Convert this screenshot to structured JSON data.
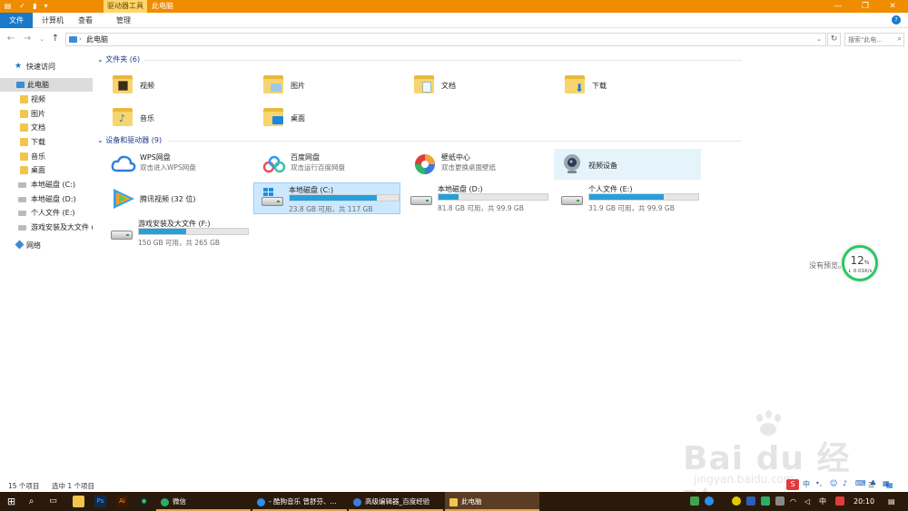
{
  "window": {
    "context_tab": "驱动器工具",
    "title": "此电脑",
    "minimize": "—",
    "maximize": "❐",
    "close": "✕"
  },
  "ribbon": {
    "tabs": [
      {
        "label": "文件"
      },
      {
        "label": "计算机"
      },
      {
        "label": "查看"
      },
      {
        "label": "管理"
      }
    ]
  },
  "address": {
    "path": "此电脑",
    "search_placeholder": "搜索\"此电...",
    "back": "←",
    "forward": "→",
    "history": "⌄",
    "up": "↑",
    "refresh": "↻"
  },
  "sidebar": {
    "items": [
      {
        "label": "快速访问",
        "icon": "star-icon"
      },
      {
        "label": "此电脑",
        "icon": "computer-icon"
      },
      {
        "label": "视频",
        "icon": "folder-icon"
      },
      {
        "label": "图片",
        "icon": "folder-icon"
      },
      {
        "label": "文档",
        "icon": "folder-icon"
      },
      {
        "label": "下载",
        "icon": "folder-icon"
      },
      {
        "label": "音乐",
        "icon": "folder-icon"
      },
      {
        "label": "桌面",
        "icon": "folder-icon"
      },
      {
        "label": "本地磁盘 (C:)",
        "icon": "drive-icon"
      },
      {
        "label": "本地磁盘 (D:)",
        "icon": "drive-icon"
      },
      {
        "label": "个人文件 (E:)",
        "icon": "drive-icon"
      },
      {
        "label": "游戏安装及大文件 (",
        "icon": "drive-icon"
      },
      {
        "label": "网络",
        "icon": "network-icon"
      }
    ]
  },
  "groups": {
    "folders_header": "文件夹 (6)",
    "devices_header": "设备和驱动器 (9)"
  },
  "folders": [
    {
      "name": "视频",
      "icon": "video-folder-icon"
    },
    {
      "name": "图片",
      "icon": "pictures-folder-icon"
    },
    {
      "name": "文档",
      "icon": "documents-folder-icon"
    },
    {
      "name": "下载",
      "icon": "downloads-folder-icon"
    },
    {
      "name": "音乐",
      "icon": "music-folder-icon"
    },
    {
      "name": "桌面",
      "icon": "desktop-folder-icon"
    }
  ],
  "devices": [
    {
      "name": "WPS网盘",
      "sub": "双击进入WPS网盘",
      "icon": "wps-cloud-icon"
    },
    {
      "name": "百度网盘",
      "sub": "双击运行百度网盘",
      "icon": "baidu-netdisk-icon"
    },
    {
      "name": "壁纸中心",
      "sub": "双击更换桌面壁纸",
      "icon": "wallpaper-center-icon"
    },
    {
      "name": "视频设备",
      "icon": "webcam-icon"
    },
    {
      "name": "腾讯视频 (32 位)",
      "icon": "tencent-video-icon"
    }
  ],
  "drives": [
    {
      "name": "本地磁盘 (C:)",
      "space": "23.8 GB 可用，共 117 GB",
      "used_fraction": 0.8,
      "icon": "windows-drive-icon"
    },
    {
      "name": "本地磁盘 (D:)",
      "space": "81.8 GB 可用，共 99.9 GB",
      "used_fraction": 0.18,
      "icon": "drive-icon"
    },
    {
      "name": "个人文件 (E:)",
      "space": "31.9 GB 可用，共 99.9 GB",
      "used_fraction": 0.68,
      "icon": "drive-icon"
    },
    {
      "name": "游戏安装及大文件 (F:)",
      "space": "150 GB 可用，共 265 GB",
      "used_fraction": 0.43,
      "icon": "drive-icon"
    }
  ],
  "preview": {
    "text": "没有预览。"
  },
  "speed_widget": {
    "percent": "12",
    "unit": "%",
    "rate": "↓ 0.01K/s"
  },
  "status": {
    "item_count": "15 个项目",
    "selected": "选中 1 个项目"
  },
  "watermark": {
    "brand": "Bai du 经验",
    "site": "jingyan.baidu.com"
  },
  "taskbar": {
    "tasks": [
      {
        "label": "微信",
        "color": "#2aae67"
      },
      {
        "label": "- 酷狗音乐 曾舒芬、...",
        "color": "#2d8cf0"
      },
      {
        "label": "高级编辑器_百度经验",
        "color": "#3d7de0"
      },
      {
        "label": "此电脑",
        "color": "#f2c54b"
      }
    ],
    "ime": "中",
    "ime2": "中",
    "clock": "20:10"
  },
  "colors": {
    "titlebar": "#f08c00",
    "accent": "#1979ca",
    "bar_fill": "#26a0da",
    "taskbar": "#2b1a0c"
  }
}
